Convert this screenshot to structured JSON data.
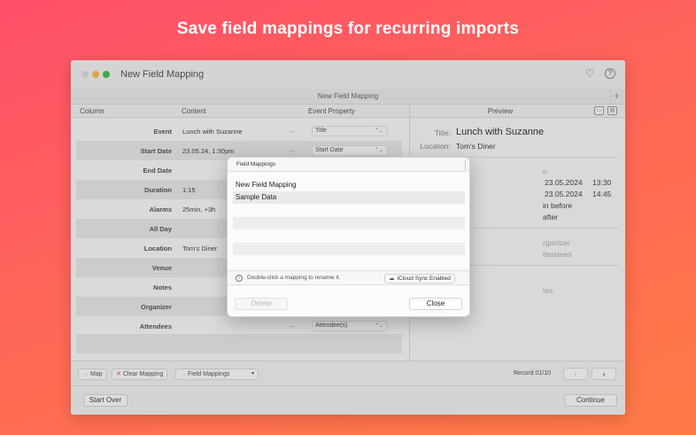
{
  "headline": "Save field mappings for recurring imports",
  "window": {
    "title": "New Field Mapping",
    "subtab": "New Field Mapping",
    "columns": {
      "column": "Column",
      "content": "Content",
      "event_property": "Event Property",
      "preview": "Preview"
    }
  },
  "rows": [
    {
      "label": "Event",
      "content": "Lunch with Suzanne",
      "arrow": "→",
      "property": "Title"
    },
    {
      "label": "Start Date",
      "content": "23.05.24, 1:30pm",
      "arrow": "→",
      "property": "Start Date"
    },
    {
      "label": "End Date",
      "content": "",
      "arrow": "",
      "property": ""
    },
    {
      "label": "Duration",
      "content": "1:15",
      "arrow": "",
      "property": ""
    },
    {
      "label": "Alarms",
      "content": "25min, +3h",
      "arrow": "",
      "property": ""
    },
    {
      "label": "All Day",
      "content": "",
      "arrow": "",
      "property": ""
    },
    {
      "label": "Location",
      "content": "Tom's Diner",
      "arrow": "",
      "property": ""
    },
    {
      "label": "Venue",
      "content": "",
      "arrow": "",
      "property": ""
    },
    {
      "label": "Notes",
      "content": "",
      "arrow": "",
      "property": ""
    },
    {
      "label": "Organizer",
      "content": "",
      "arrow": "",
      "property": ""
    },
    {
      "label": "Attendees",
      "content": "",
      "arrow": "→",
      "property": "Attendee(s)"
    }
  ],
  "preview": {
    "title_label": "Title:",
    "title_value": "Lunch with Suzanne",
    "location_label": "Location:",
    "location_value": "Tom's Diner",
    "partial": {
      "o": "o",
      "start_date": "23.05.2024",
      "start_time": "13:30",
      "end_date": "23.05.2024",
      "end_time": "14:45",
      "alarm1": "in before",
      "alarm2": "after",
      "organizer": "rganizer",
      "attendees": "ttendees",
      "notes": "tes"
    }
  },
  "bottombar": {
    "map": "Map",
    "clear": "Clear Mapping",
    "field_mappings": "Field Mappings",
    "record": "Record 01/10",
    "prev": "‹",
    "next": "›"
  },
  "footer": {
    "start_over": "Start Over",
    "continue": "Continue"
  },
  "dialog": {
    "title": "Field Mappings",
    "mappings": [
      "New Field Mapping",
      "Sample Data"
    ],
    "info": "Double-click a mapping to rename it.",
    "sync": "iCloud Sync Enabled",
    "delete": "Delete",
    "close": "Close"
  }
}
